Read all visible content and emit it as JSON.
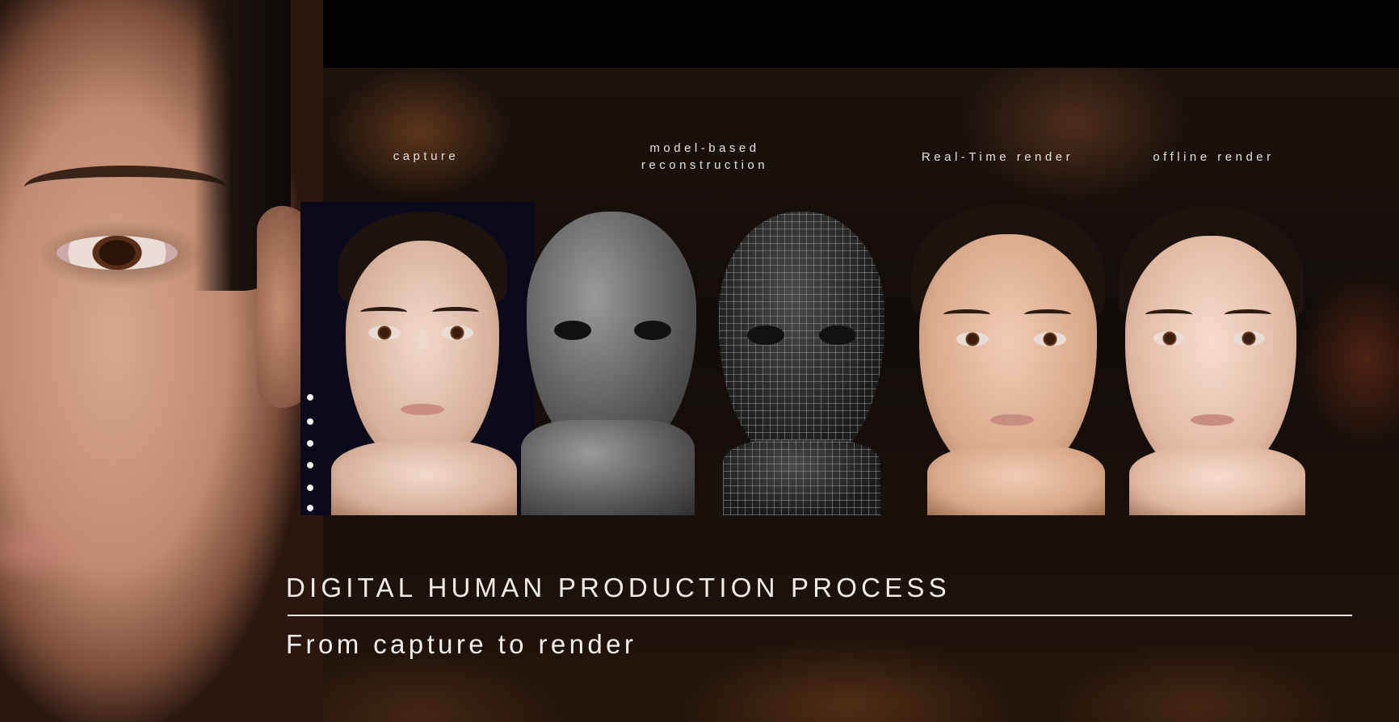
{
  "stages": [
    {
      "label_lines": [
        "capture"
      ]
    },
    {
      "label_lines": [
        "model-based",
        "reconstruction"
      ]
    },
    {
      "label_lines": [
        "Real-Time render"
      ]
    },
    {
      "label_lines": [
        "offline render"
      ]
    }
  ],
  "footer": {
    "title": "DIGITAL HUMAN PRODUCTION PROCESS",
    "subtitle": "From capture to render"
  }
}
